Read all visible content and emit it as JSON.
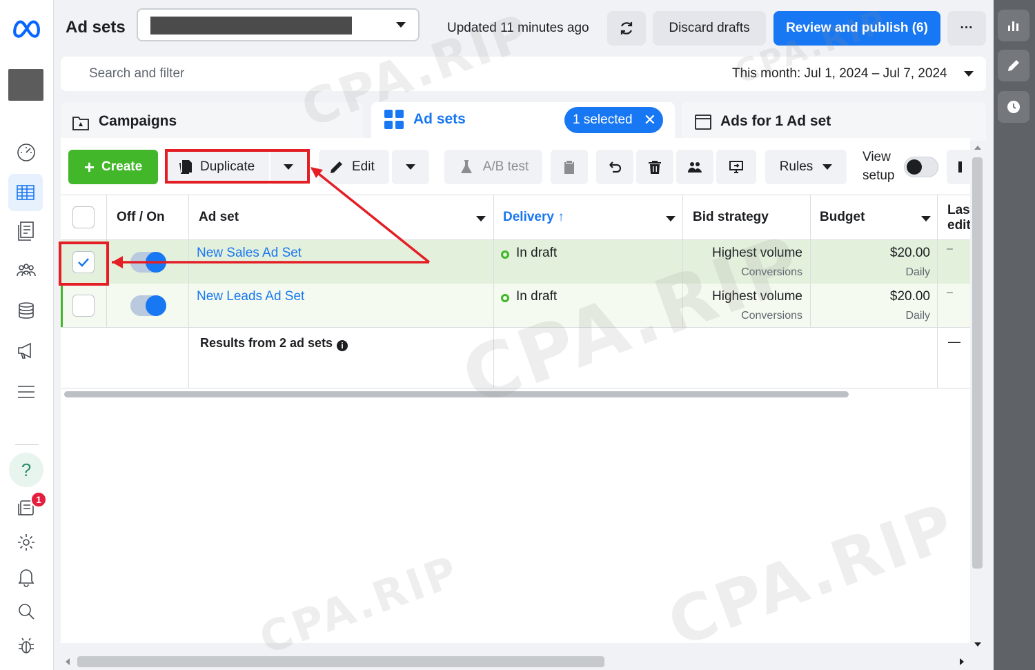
{
  "header": {
    "title": "Ad sets",
    "updated": "Updated 11 minutes ago",
    "discard_label": "Discard drafts",
    "publish_label": "Review and publish (6)",
    "more_label": "···"
  },
  "search": {
    "placeholder": "Search and filter",
    "date_range": "This month: Jul 1, 2024 – Jul 7, 2024"
  },
  "tabs": {
    "campaigns": "Campaigns",
    "adsets": "Ad sets",
    "selected_pill": "1 selected",
    "ads": "Ads for 1 Ad set"
  },
  "toolbar": {
    "create": "Create",
    "duplicate": "Duplicate",
    "edit": "Edit",
    "ab_test": "A/B test",
    "rules": "Rules",
    "view_setup_1": "View",
    "view_setup_2": "setup"
  },
  "table": {
    "headers": {
      "off_on": "Off / On",
      "ad_set": "Ad set",
      "delivery": "Delivery ↑",
      "bid_strategy": "Bid strategy",
      "budget": "Budget",
      "last_edit_1": "Last",
      "last_edit_2": "edit"
    },
    "rows": [
      {
        "name": "New Sales Ad Set",
        "checked": true,
        "on": true,
        "delivery": "In draft",
        "bid": "Highest volume",
        "bid_sub": "Conversions",
        "budget": "$20.00",
        "budget_sub": "Daily",
        "last": "–"
      },
      {
        "name": "New Leads Ad Set",
        "checked": false,
        "on": true,
        "delivery": "In draft",
        "bid": "Highest volume",
        "bid_sub": "Conversions",
        "budget": "$20.00",
        "budget_sub": "Daily",
        "last": "–"
      }
    ],
    "results": "Results from 2 ad sets",
    "results_last": "—"
  },
  "nav": {
    "help": "?",
    "notification_count": "1"
  },
  "watermark": "CPA.RIP",
  "colors": {
    "accent": "#1877f2",
    "create": "#42b72a",
    "annotation": "#e41e25"
  }
}
